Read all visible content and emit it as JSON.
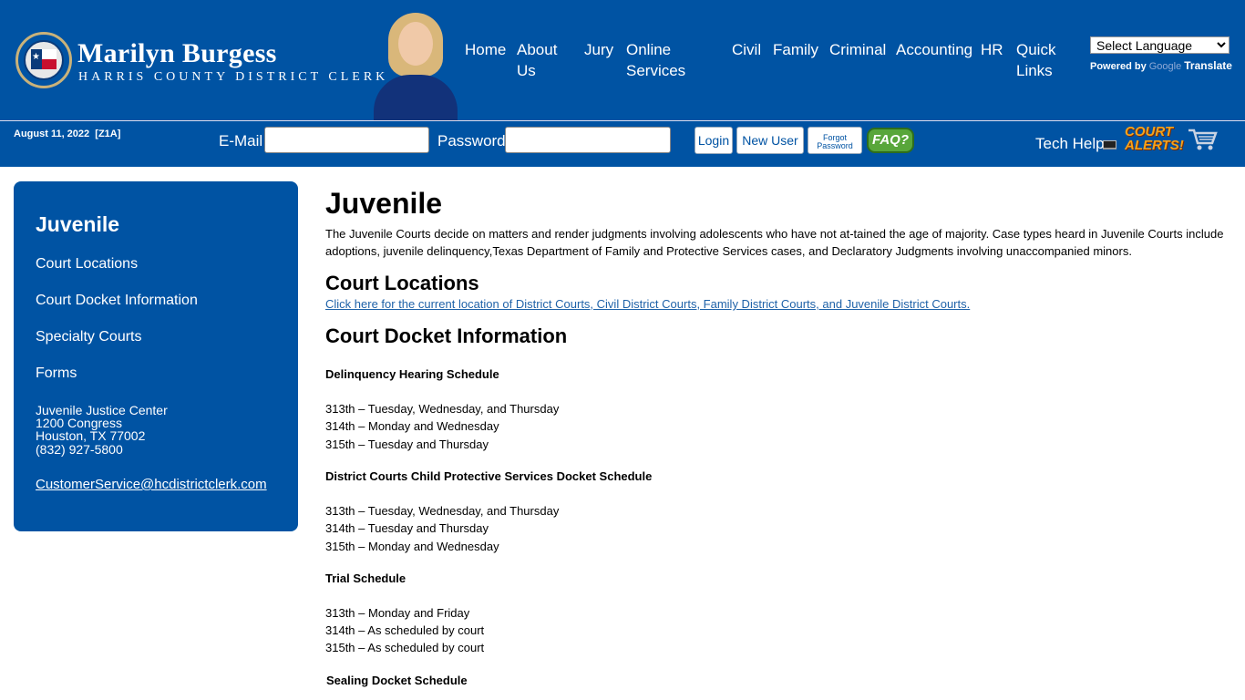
{
  "header": {
    "name": "Marilyn Burgess",
    "subtitle": "HARRIS COUNTY DISTRICT CLERK",
    "nav": [
      {
        "label": "Home"
      },
      {
        "label": "About Us"
      },
      {
        "label": "Jury"
      },
      {
        "label": "Online Services"
      },
      {
        "label": "Civil"
      },
      {
        "label": "Family"
      },
      {
        "label": "Criminal"
      },
      {
        "label": "Accounting"
      },
      {
        "label": "HR"
      },
      {
        "label": "Quick Links"
      }
    ],
    "language": {
      "selected": "Select Language",
      "powered_by": "Powered by",
      "google": "Google",
      "translate": "Translate"
    }
  },
  "loginbar": {
    "date": "August 11, 2022",
    "code": "[Z1A]",
    "email_label": "E-Mail",
    "email_value": "",
    "password_label": "Password",
    "password_value": "",
    "login": "Login",
    "new_user": "New User",
    "forgot_password": "Forgot Password",
    "faq": "FAQ?",
    "tech_help": "Tech Help",
    "court_alerts": "COURT ALERTS!"
  },
  "sidebar": {
    "title": "Juvenile",
    "links": [
      "Court Locations",
      "Court Docket Information",
      "Specialty Courts",
      "Forms"
    ],
    "address": [
      "Juvenile Justice Center",
      "1200 Congress",
      "Houston, TX 77002",
      "(832) 927-5800"
    ],
    "email": "CustomerService@hcdistrictclerk.com"
  },
  "main": {
    "title": "Juvenile",
    "intro": "The Juvenile Courts decide on matters and render judgments involving adolescents who have not at-tained the age of majority. Case types heard in Juvenile Courts include adoptions, juvenile delinquency,Texas Department of Family and Protective Services cases, and Declaratory Judgments involving unaccompanied minors.",
    "court_locations_heading": "Court Locations",
    "court_locations_link": "Click here for the current location of District Courts, Civil District Courts, Family District Courts, and Juvenile District Courts.",
    "docket_heading": "Court Docket Information",
    "schedules": [
      {
        "title": "Delinquency Hearing Schedule",
        "lines": [
          "313th – Tuesday, Wednesday, and Thursday",
          "314th – Monday and Wednesday",
          "315th – Tuesday and Thursday"
        ]
      },
      {
        "title": "District Courts Child Protective Services Docket Schedule",
        "lines": [
          "313th – Tuesday, Wednesday, and Thursday",
          "314th – Tuesday and Thursday",
          "315th – Monday and Wednesday"
        ]
      },
      {
        "title": "Trial Schedule",
        "lines": [
          "313th – Monday and Friday",
          "314th – As scheduled by court",
          "315th – As scheduled by court"
        ]
      },
      {
        "title": "Sealing Docket Schedule",
        "lines": []
      }
    ]
  },
  "colors": {
    "brand_blue": "#0053a3",
    "link_blue": "#1f62a8",
    "faq_green": "#58a63a",
    "alerts_orange": "#f6a21a"
  }
}
